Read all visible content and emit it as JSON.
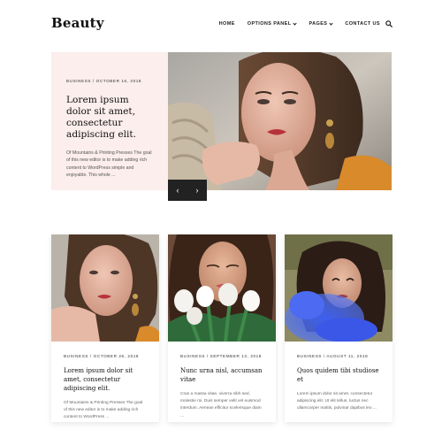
{
  "site": {
    "logo": "Beauty"
  },
  "nav": {
    "items": [
      {
        "label": "HOME",
        "dropdown": false
      },
      {
        "label": "OPTIONS PANEL",
        "dropdown": true
      },
      {
        "label": "PAGES",
        "dropdown": true
      },
      {
        "label": "CONTACT US",
        "dropdown": false
      }
    ],
    "search_icon": "search-icon"
  },
  "hero": {
    "meta": "BUSINESS / OCTOBER 16, 2018",
    "title": "Lorem ipsum dolor sit amet, consectetur adipiscing elit.",
    "excerpt": "Of Mountains & Printing Presses The goal of this new editor is to make adding rich content to WordPress simple and enjoyable. This whole ...",
    "prev_icon": "chevron-left-icon",
    "next_icon": "chevron-right-icon",
    "prev_glyph": "‹",
    "next_glyph": "›"
  },
  "cards": [
    {
      "meta": "BUSINESS / OCTOBER 26, 2018",
      "title": "Lorem ipsum dolor sit amet, consectetur adipiscing elit.",
      "excerpt": "Of Mountains & Printing Presses The goal of this new editor is to make adding rich content to WordPress ..."
    },
    {
      "meta": "BUSINESS / SEPTEMBER 13, 2018",
      "title": "Nunc urna nisl, accumsan vitae",
      "excerpt": "Cras a massa vitae, viverra nibh sed, molestie mi. Duis semper velit vel euismod interdum. Aenean efficitur scelerisque diam ..."
    },
    {
      "meta": "BUSINESS / AUGUST 11, 2018",
      "title": "Quos quidem tibi studiose et",
      "excerpt": "Lorem ipsum dolor sit amet, consectetur adipiscing elit. Ut elit tellus, luctus nec ullamcorper mattis, pulvinar dapibus leo ..."
    }
  ],
  "colors": {
    "hero_card_bg": "#fbeeed",
    "slider_bg": "#222222",
    "text_dark": "#111111"
  }
}
